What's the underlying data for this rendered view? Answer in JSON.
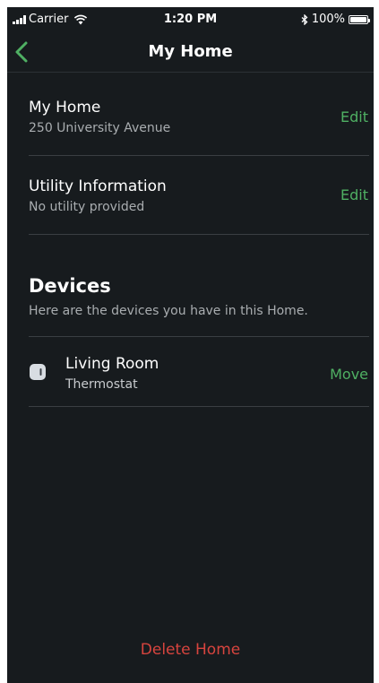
{
  "status_bar": {
    "carrier": "Carrier",
    "time": "1:20 PM",
    "battery": "100%",
    "battery_level": 1.0,
    "icons": [
      "signal-icon",
      "wifi-icon",
      "bluetooth-icon",
      "battery-icon"
    ]
  },
  "nav": {
    "title": "My Home",
    "back_icon": "chevron-left-icon"
  },
  "home": {
    "title": "My Home",
    "address": "250 University Avenue",
    "action": "Edit"
  },
  "utility": {
    "title": "Utility Information",
    "subtitle": "No utility provided",
    "action": "Edit"
  },
  "devices": {
    "title": "Devices",
    "subtitle": "Here are the devices you have in this Home.",
    "items": [
      {
        "name": "Living Room",
        "type": "Thermostat",
        "action": "Move",
        "icon": "thermostat-icon"
      }
    ]
  },
  "footer": {
    "delete_label": "Delete Home"
  },
  "colors": {
    "background": "#171b1e",
    "accent": "#4fb063",
    "danger": "#d7443e",
    "secondary_text": "#a9adb0",
    "divider": "#3a3f43"
  }
}
